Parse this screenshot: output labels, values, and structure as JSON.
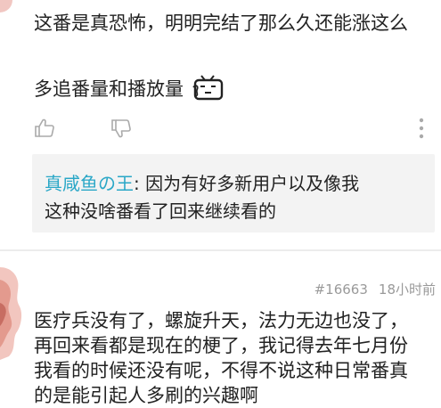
{
  "comment_top": {
    "line1": "这番是真恐怖，明明完结了那么久还能涨这么",
    "line2": "多追番量和播放量"
  },
  "actions": {
    "like_icon": "thumbs-up-icon",
    "dislike_icon": "thumbs-down-icon",
    "more_icon": "more-vertical-icon"
  },
  "reply": {
    "author": "真咸鱼の王",
    "colon": ": ",
    "text_line1": "因为有好多新用户以及像我",
    "text_line2": "这种没啥番看了回来继续看的"
  },
  "comment_second": {
    "floor": "#16663",
    "time": "18小时前",
    "lines": [
      "医疗兵没有了，螺旋升天，法力无边也没了，",
      "再回来看都是现在的梗了，我记得去年七月份",
      "我看的时候还没有呢，不得不说这种日常番真",
      "的是能引起人多刷的兴趣啊"
    ]
  },
  "colors": {
    "accent": "#2aa7c7",
    "reply_bg": "#f3f3f3",
    "meta_text": "#9a9a9a"
  }
}
